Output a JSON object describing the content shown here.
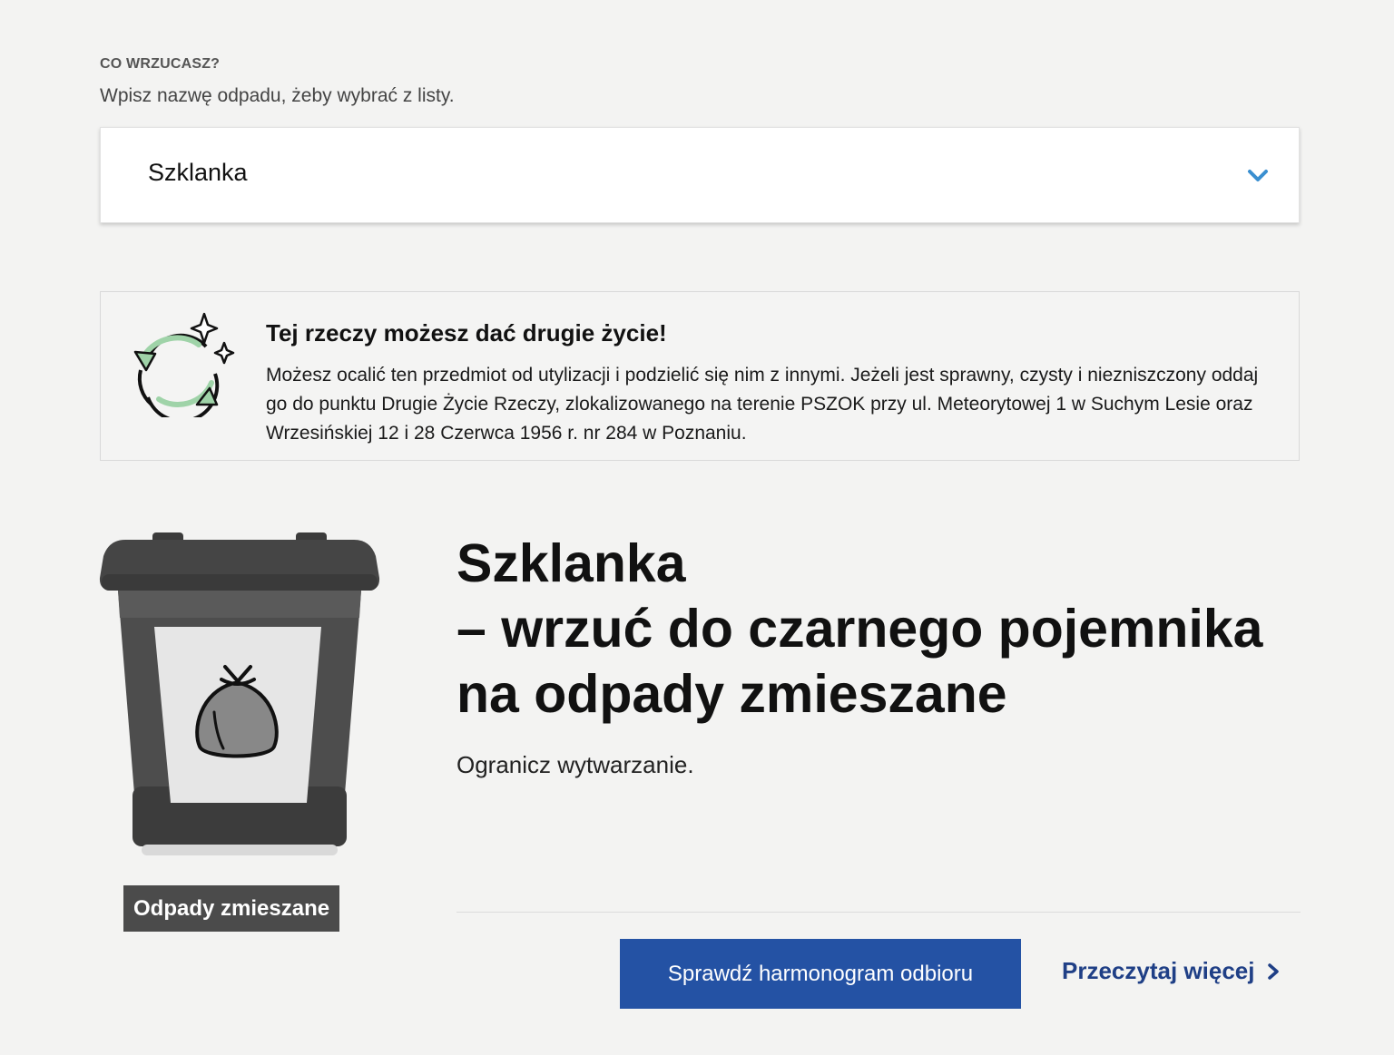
{
  "search": {
    "section_label": "CO WRZUCASZ?",
    "helper": "Wpisz nazwę odpadu, żeby wybrać z listy.",
    "selected_value": "Szklanka",
    "chevron_icon": "chevron-down-icon",
    "accent_color": "#3a8fd0"
  },
  "info": {
    "icon": "recycle-sparkle-icon",
    "title": "Tej rzeczy możesz dać drugie życie!",
    "body": "Możesz ocalić ten przedmiot od utylizacji i podzielić się nim z innymi. Jeżeli jest sprawny, czysty i niezniszczony oddaj go do punktu Drugie Życie Rzeczy, zlokalizowanego na terenie PSZOK przy ul. Meteorytowej 1 w Suchym Lesie oraz Wrzesińskiej 12 i 28 Czerwca 1956 r. nr 284 w Poznaniu."
  },
  "result": {
    "bin_icon": "black-bin-icon",
    "bin_label": "Odpady zmieszane",
    "headline_line1": "Szklanka",
    "headline_line2": "– wrzuć do czarnego pojemnika",
    "headline_line3": "na odpady zmieszane",
    "subtext": "Ogranicz wytwarzanie.",
    "schedule_button": "Sprawdź harmonogram odbioru",
    "read_more": "Przeczytaj więcej",
    "button_color": "#2452a4",
    "link_color": "#1f3f86"
  }
}
